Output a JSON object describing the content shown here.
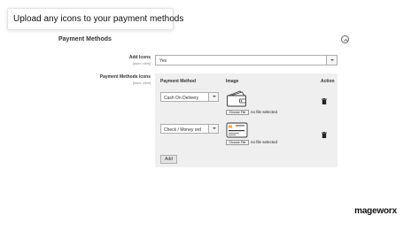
{
  "banner": {
    "text": "Upload any icons to your payment methods"
  },
  "section": {
    "title": "Payment Methods"
  },
  "icons": {
    "collapse": "collapse-icon",
    "trash": "trash-icon",
    "wallet": "wallet-image",
    "card": "credit-card-image"
  },
  "add_icons": {
    "label": "Add Icons",
    "scope": "[store view]",
    "value": "Yes"
  },
  "methods_icons": {
    "label": "Payment Methods Icons",
    "scope": "[store view]",
    "headers": {
      "method": "Payment Method",
      "image": "Image",
      "action": "Action"
    },
    "rows": [
      {
        "method": "Cash On Delivery",
        "choose": "Choose File",
        "file": "no file selected"
      },
      {
        "method": "Check / Money ord",
        "choose": "Choose File",
        "file": "no file selected"
      }
    ],
    "add_label": "Add"
  },
  "brand": "mageworx"
}
